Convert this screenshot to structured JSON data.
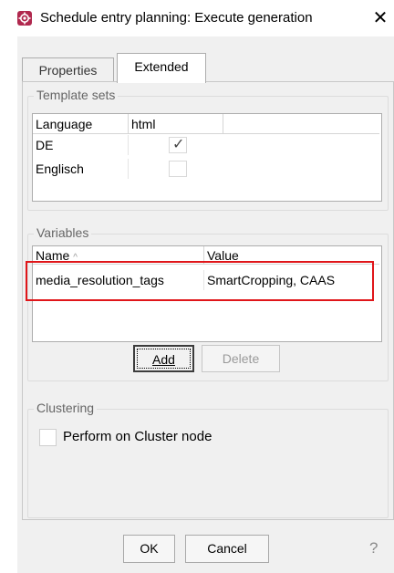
{
  "window": {
    "title": "Schedule entry planning: Execute generation",
    "close_glyph": "✕"
  },
  "tabs": [
    {
      "label": "Properties",
      "active": false
    },
    {
      "label": "Extended",
      "active": true
    }
  ],
  "template_sets": {
    "legend": "Template sets",
    "columns": [
      "Language",
      "html"
    ],
    "rows": [
      {
        "language": "DE",
        "html_checked": true
      },
      {
        "language": "Englisch",
        "html_checked": false
      }
    ]
  },
  "variables": {
    "legend": "Variables",
    "columns": [
      "Name",
      "Value"
    ],
    "sort_indicator": "^",
    "rows": [
      {
        "name": "media_resolution_tags",
        "value": "SmartCropping, CAAS"
      }
    ],
    "add_label": "Add",
    "delete_label": "Delete"
  },
  "clustering": {
    "legend": "Clustering",
    "checkbox_label": "Perform on Cluster node",
    "checked": false
  },
  "footer": {
    "ok_label": "OK",
    "cancel_label": "Cancel",
    "help_glyph": "?"
  },
  "colors": {
    "highlight": "#e0161a",
    "app_icon": "#b0284e"
  }
}
